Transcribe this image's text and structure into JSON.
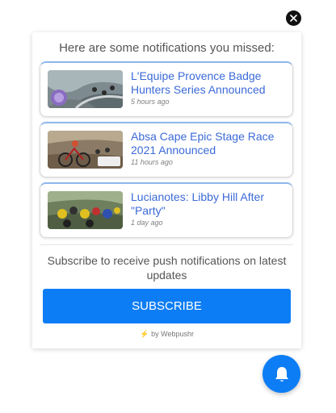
{
  "popup": {
    "title": "Here are some notifications you missed:",
    "notifications": [
      {
        "title": "L'Equipe Provence Badge Hunters Series Announced",
        "time": "5 hours ago"
      },
      {
        "title": "Absa Cape Epic Stage Race 2021 Announced",
        "time": "11 hours ago"
      },
      {
        "title": "Lucianotes: Libby Hill After \"Party\"",
        "time": "1 day ago"
      }
    ],
    "subscribe_text": "Subscribe to receive push notifications on latest updates",
    "subscribe_label": "SUBSCRIBE",
    "powered_by": "by Webpushr"
  },
  "icons": {
    "close": "close-icon",
    "bell": "bell-icon",
    "bolt": "lightning-icon"
  },
  "colors": {
    "accent": "#0d7df5",
    "link": "#3b6ad8",
    "bolt": "#f5b200"
  }
}
